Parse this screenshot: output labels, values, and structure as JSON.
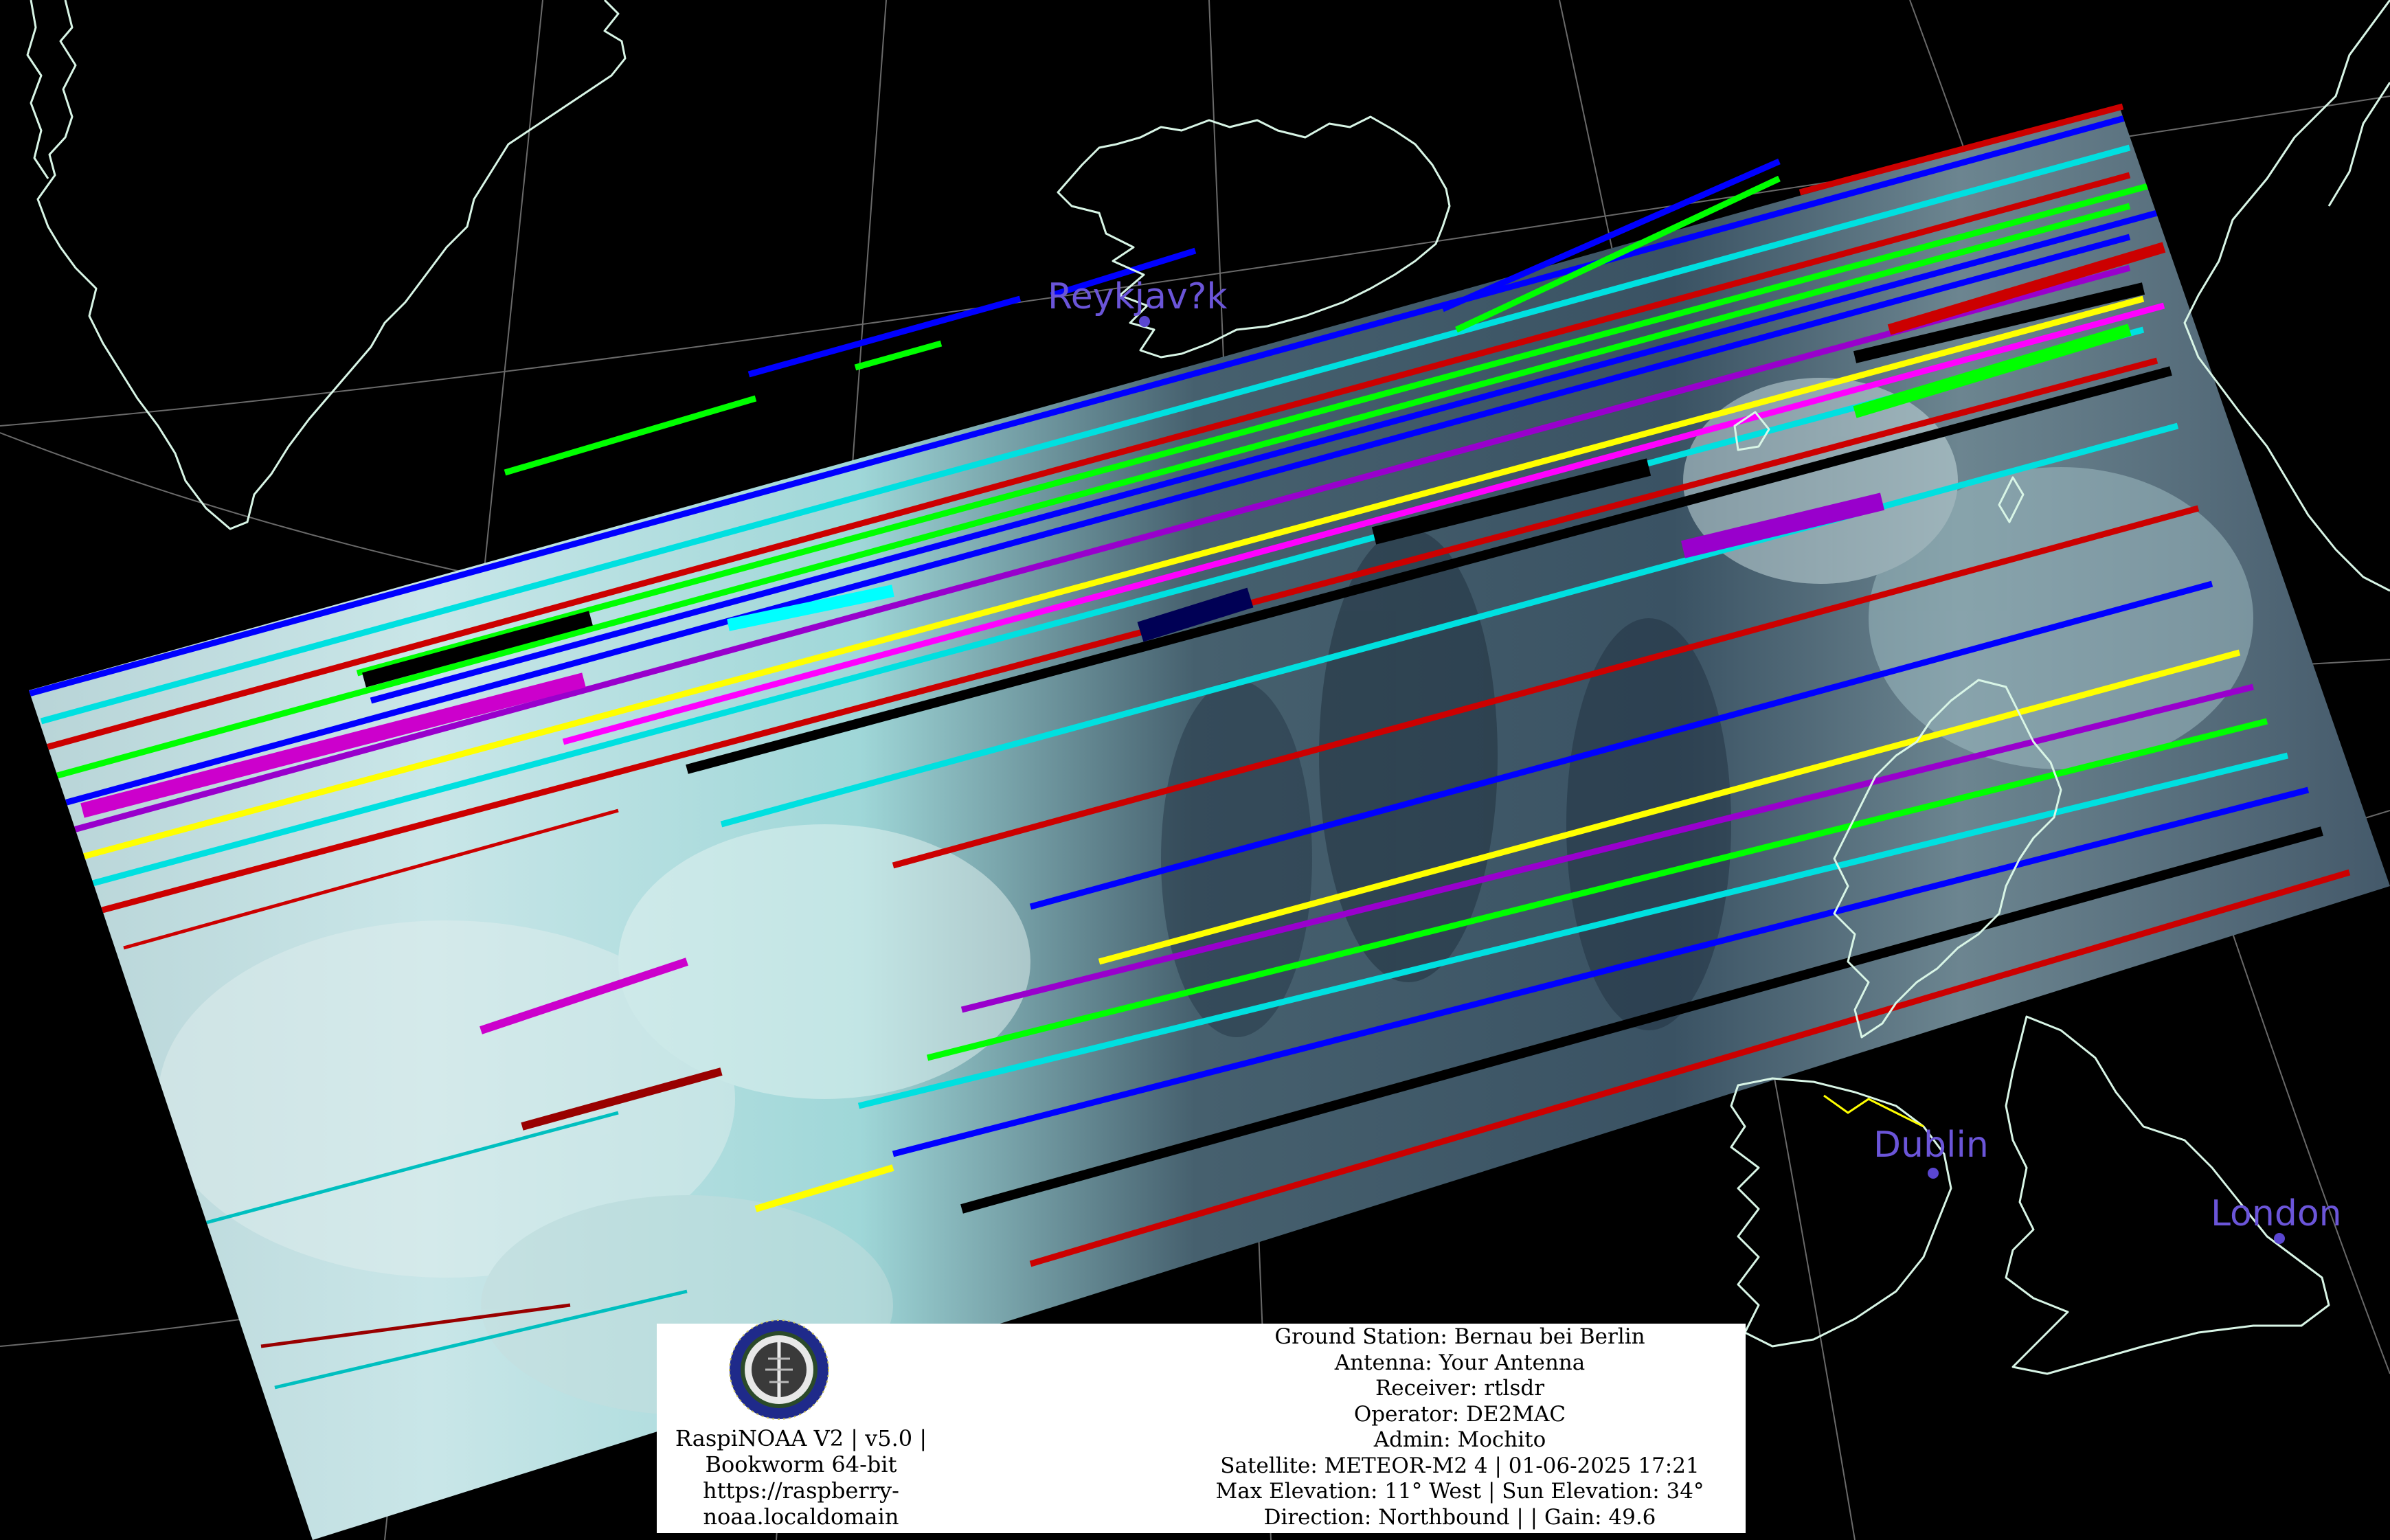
{
  "cities": [
    {
      "name": "Reykjav?k"
    },
    {
      "name": "Dublin"
    },
    {
      "name": "London"
    }
  ],
  "info": {
    "software": [
      "RaspiNOAA V2 | v5.0 |",
      "Bookworm 64-bit",
      "https://raspberry-",
      "noaa.localdomain"
    ],
    "ground_station": "Ground Station: Bernau bei Berlin",
    "antenna": "Antenna: Your Antenna",
    "receiver": "Receiver: rtlsdr",
    "operator": "Operator: DE2MAC",
    "admin": "Admin: Mochito",
    "satellite": "Satellite: METEOR-M2 4 | 01-06-2025 17:21",
    "elevation": "Max Elevation: 11° West | Sun Elevation: 34°",
    "direction": "Direction: Northbound | | Gain: 49.6"
  },
  "colors": {
    "background": "#000000",
    "coastline": "#d8f5e6",
    "graticule": "#9a9a9a",
    "city_label": "#6b55d9",
    "cloud_light": "#c9e4e6",
    "cloud_cyan": "#8fe0e0",
    "ocean_dark": "#2b3d4b",
    "border_yellow": "#ffff00"
  }
}
